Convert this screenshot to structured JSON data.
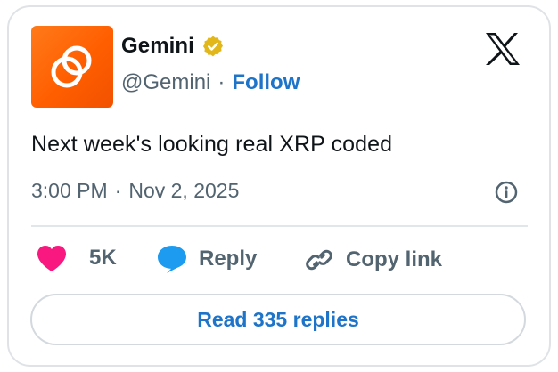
{
  "author": {
    "name": "Gemini",
    "handle": "@Gemini",
    "separator": "·",
    "follow_label": "Follow",
    "verified": true
  },
  "tweet": {
    "text": "Next week's looking real XRP coded",
    "time": "3:00 PM",
    "separator": "·",
    "date": "Nov 2, 2025"
  },
  "actions": {
    "like_count": "5K",
    "reply_label": "Reply",
    "copy_label": "Copy link"
  },
  "read_replies_label": "Read 335 replies",
  "icons": {
    "avatar": "gemini-logo",
    "verified": "verified-badge-icon",
    "platform": "x-logo-icon",
    "info": "info-icon",
    "like": "heart-icon",
    "reply": "speech-bubble-icon",
    "copy": "link-icon"
  },
  "colors": {
    "accent": "#1d74c8",
    "heart": "#f91880",
    "reply_bubble": "#1d9bf0",
    "avatar_bg": "#ff5e00",
    "verified_badge": "#e2b719",
    "muted_text": "#536471"
  }
}
